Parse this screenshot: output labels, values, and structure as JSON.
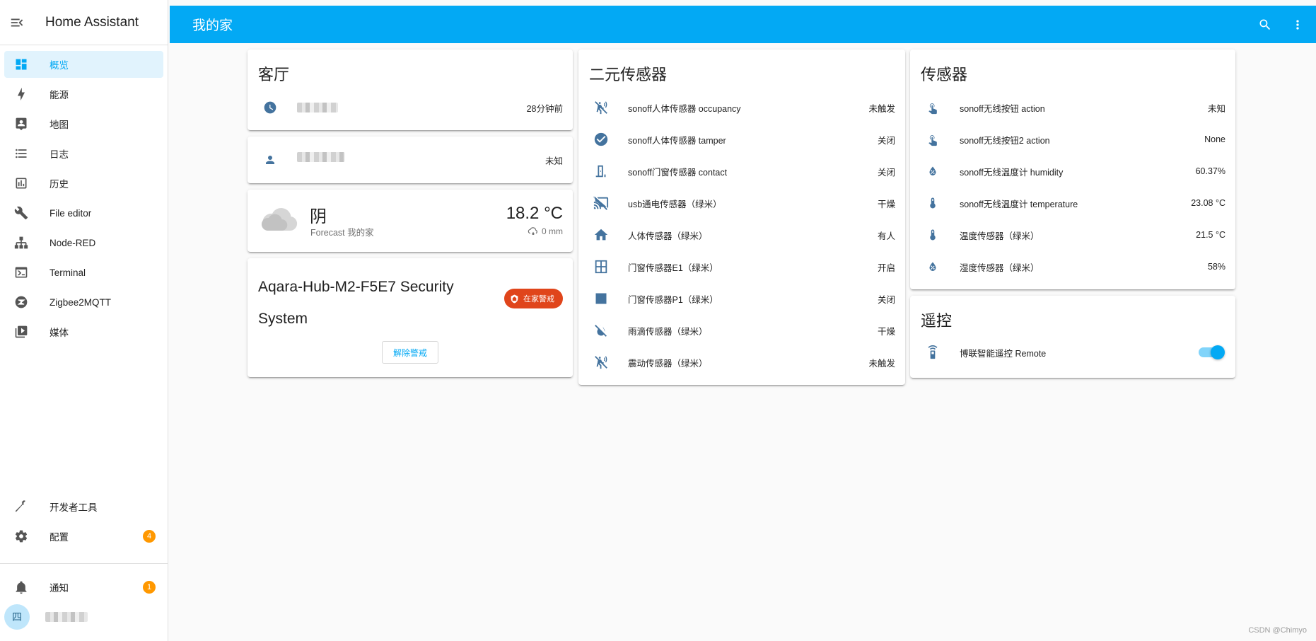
{
  "app": {
    "title": "Home Assistant",
    "page_title": "我的家"
  },
  "sidebar": {
    "items": [
      {
        "label": "概览",
        "icon": "dashboard-icon",
        "active": true
      },
      {
        "label": "能源",
        "icon": "lightning-icon"
      },
      {
        "label": "地图",
        "icon": "map-account-icon"
      },
      {
        "label": "日志",
        "icon": "list-icon"
      },
      {
        "label": "历史",
        "icon": "chart-box-icon"
      },
      {
        "label": "File editor",
        "icon": "wrench-icon"
      },
      {
        "label": "Node-RED",
        "icon": "sitemap-icon"
      },
      {
        "label": "Terminal",
        "icon": "console-icon"
      },
      {
        "label": "Zigbee2MQTT",
        "icon": "zigbee-icon"
      },
      {
        "label": "媒体",
        "icon": "media-icon"
      }
    ],
    "bottom_items": [
      {
        "label": "开发者工具",
        "icon": "hammer-icon"
      },
      {
        "label": "配置",
        "icon": "cog-icon",
        "badge": "4"
      }
    ],
    "notifications": {
      "label": "通知",
      "badge": "1",
      "icon": "bell-icon"
    },
    "user": {
      "avatar_letter": "四"
    }
  },
  "cards": {
    "living_room": {
      "title": "客厅",
      "clock_row": {
        "state": "28分钟前"
      },
      "person_row": {
        "state": "未知"
      }
    },
    "weather": {
      "condition": "阴",
      "subtitle": "Forecast 我的家",
      "temperature": "18.2 °C",
      "precipitation": "0 mm"
    },
    "alarm": {
      "name": "Aqara-Hub-M2-F5E7 Security System",
      "status": "在家警戒",
      "disarm_label": "解除警戒"
    },
    "binary_sensors": {
      "title": "二元传感器",
      "rows": [
        {
          "name": "sonoff人体传感器 occupancy",
          "state": "未触发",
          "icon": "motion-sensor-off-icon"
        },
        {
          "name": "sonoff人体传感器 tamper",
          "state": "关闭",
          "icon": "check-circle-icon"
        },
        {
          "name": "sonoff门窗传感器 contact",
          "state": "关闭",
          "icon": "door-closed-icon"
        },
        {
          "name": "usb通电传感器（绿米）",
          "state": "干燥",
          "icon": "cast-off-icon"
        },
        {
          "name": "人体传感器（绿米）",
          "state": "有人",
          "icon": "home-icon"
        },
        {
          "name": "门窗传感器E1（绿米）",
          "state": "开启",
          "icon": "window-open-icon"
        },
        {
          "name": "门窗传感器P1（绿米）",
          "state": "关闭",
          "icon": "square-icon"
        },
        {
          "name": "雨滴传感器（绿米）",
          "state": "干燥",
          "icon": "water-off-icon"
        },
        {
          "name": "震动传感器（绿米）",
          "state": "未触发",
          "icon": "vibrate-off-icon"
        }
      ]
    },
    "sensors": {
      "title": "传感器",
      "rows": [
        {
          "name": "sonoff无线按钮 action",
          "state": "未知",
          "icon": "gesture-tap-icon"
        },
        {
          "name": "sonoff无线按钮2 action",
          "state": "None",
          "icon": "gesture-tap-icon"
        },
        {
          "name": "sonoff无线温度计 humidity",
          "state": "60.37%",
          "icon": "water-percent-icon"
        },
        {
          "name": "sonoff无线温度计 temperature",
          "state": "23.08 °C",
          "icon": "thermometer-icon"
        },
        {
          "name": "温度传感器（绿米）",
          "state": "21.5 °C",
          "icon": "thermometer-icon"
        },
        {
          "name": "湿度传感器（绿米）",
          "state": "58%",
          "icon": "water-percent-icon"
        }
      ]
    },
    "remote": {
      "title": "遥控",
      "rows": [
        {
          "name": "博联智能遥控 Remote",
          "state_on": true,
          "icon": "remote-icon"
        }
      ]
    }
  },
  "watermark": "CSDN @Chimyo",
  "colors": {
    "primary": "#03a9f4",
    "icon": "#44739e",
    "badge": "#ff9800",
    "alarm": "#e0451b"
  }
}
